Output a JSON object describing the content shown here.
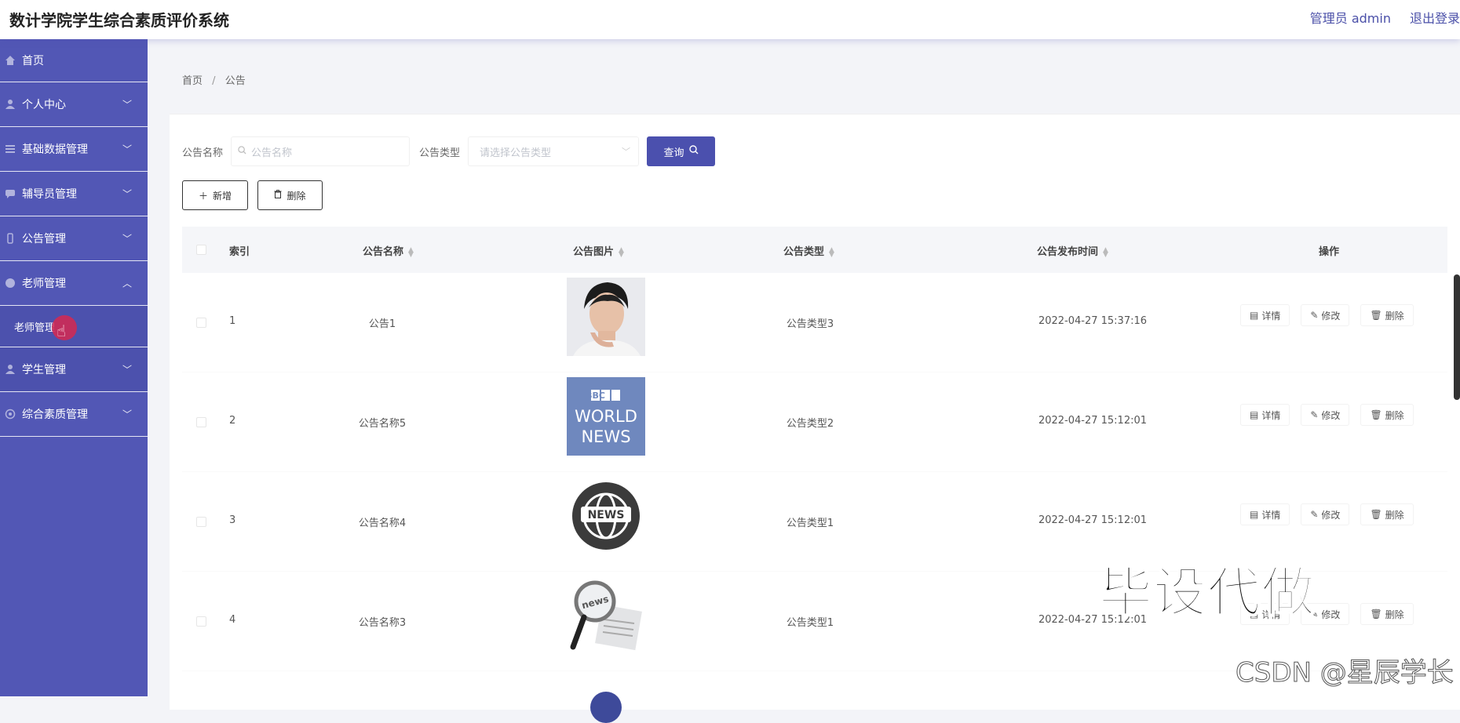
{
  "app": {
    "title": "数计学院学生综合素质评价系统",
    "admin_label": "管理员 admin",
    "logout_label": "退出登录"
  },
  "sidebar": {
    "items": [
      {
        "label": "首页",
        "icon": "home-icon",
        "expanded": false
      },
      {
        "label": "个人中心",
        "icon": "user-icon",
        "expanded": false
      },
      {
        "label": "基础数据管理",
        "icon": "list-icon",
        "expanded": false
      },
      {
        "label": "辅导员管理",
        "icon": "chat-icon",
        "expanded": false
      },
      {
        "label": "公告管理",
        "icon": "phone-icon",
        "expanded": false
      },
      {
        "label": "老师管理",
        "icon": "palette-icon",
        "expanded": true
      },
      {
        "label": "学生管理",
        "icon": "user-icon",
        "expanded": false
      },
      {
        "label": "综合素质管理",
        "icon": "badge-icon",
        "expanded": false
      }
    ],
    "submenu": {
      "label": "老师管理"
    }
  },
  "breadcrumb": {
    "home": "首页",
    "current": "公告",
    "separator": "/"
  },
  "search": {
    "name_label": "公告名称",
    "name_placeholder": "公告名称",
    "type_label": "公告类型",
    "type_placeholder": "请选择公告类型",
    "query_label": "查询"
  },
  "actions": {
    "add_label": "新增",
    "delete_label": "删除"
  },
  "table": {
    "headers": {
      "index": "索引",
      "name": "公告名称",
      "image": "公告图片",
      "type": "公告类型",
      "time": "公告发布时间",
      "ops": "操作"
    },
    "op_labels": {
      "detail": "详情",
      "edit": "修改",
      "delete": "删除"
    },
    "rows": [
      {
        "index": "1",
        "name": "公告1",
        "image": "portrait-photo",
        "type": "公告类型3",
        "time": "2022-04-27 15:37:16"
      },
      {
        "index": "2",
        "name": "公告名称5",
        "image": "bbc-world-news-logo",
        "type": "公告类型2",
        "time": "2022-04-27 15:12:01",
        "image_text_1": "BBC",
        "image_text_2": "WORLD",
        "image_text_3": "NEWS"
      },
      {
        "index": "3",
        "name": "公告名称4",
        "image": "news-globe-icon",
        "type": "公告类型1",
        "time": "2022-04-27 15:12:01",
        "image_text_1": "NEWS"
      },
      {
        "index": "4",
        "name": "公告名称3",
        "image": "news-magnifier-icon",
        "type": "公告类型1",
        "time": "2022-04-27 15:12:01",
        "image_text_1": "news"
      }
    ]
  },
  "overlay": {
    "watermark": "毕设代做",
    "csdn": "CSDN @星辰学长"
  },
  "colors": {
    "sidebar": "#5257b5",
    "accent": "#4b50ae",
    "header_bg": "#ffffff",
    "table_head_bg": "#f5f6f9"
  }
}
